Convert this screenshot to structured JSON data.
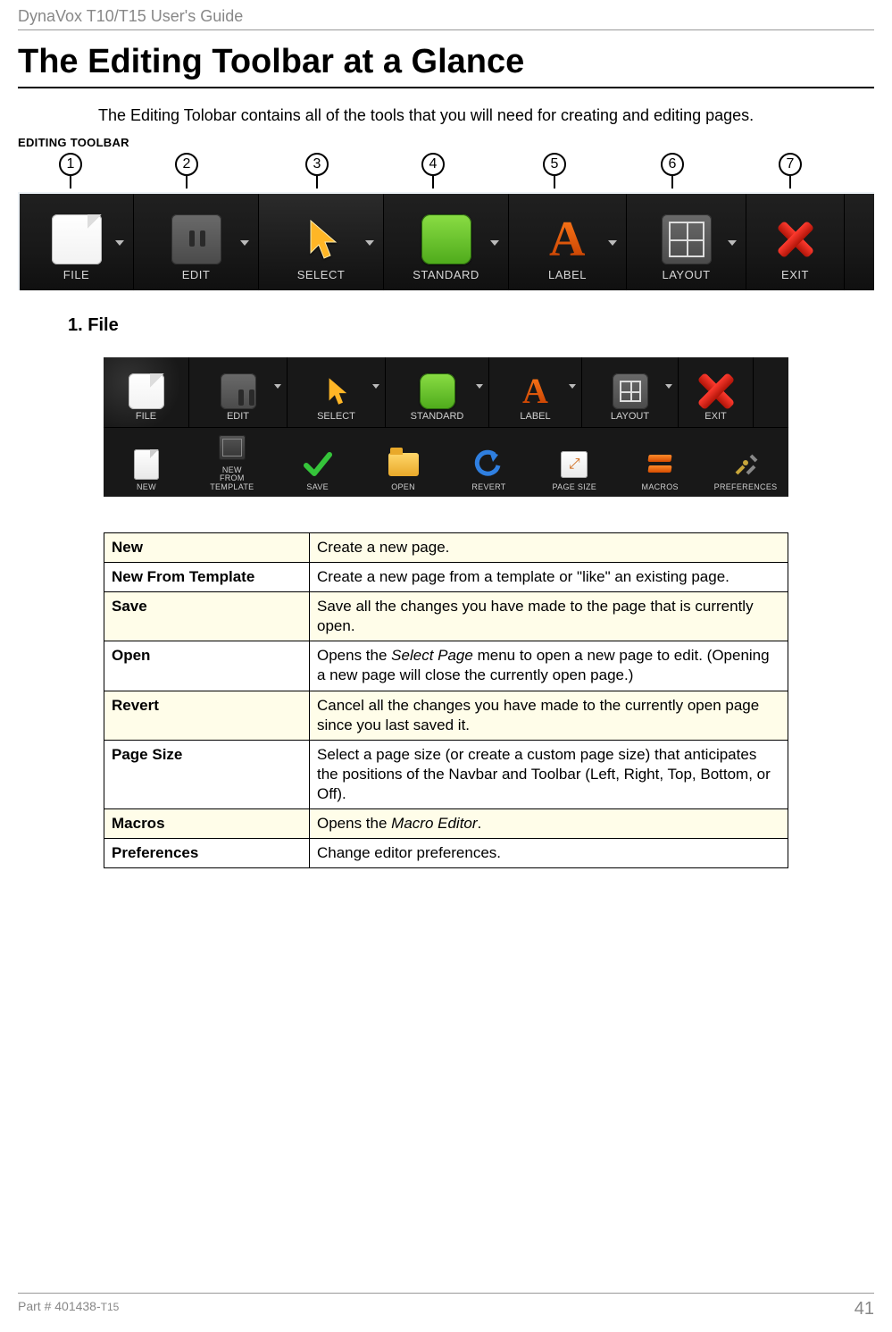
{
  "doc_header": "DynaVox T10/T15 User's Guide",
  "page_title": "The Editing Toolbar at a Glance",
  "intro_text": "The Editing Tolobar contains all of the tools that you will need for creating and editing pages.",
  "figure_label": "EDITING TOOLBAR",
  "callout_numbers": [
    "1",
    "2",
    "3",
    "4",
    "5",
    "6",
    "7"
  ],
  "toolbar_main": [
    {
      "label": "FILE"
    },
    {
      "label": "EDIT"
    },
    {
      "label": "SELECT"
    },
    {
      "label": "STANDARD"
    },
    {
      "label": "LABEL"
    },
    {
      "label": "LAYOUT"
    },
    {
      "label": "EXIT"
    }
  ],
  "section_heading": "1. File",
  "toolbar2_top": [
    {
      "label": "FILE"
    },
    {
      "label": "EDIT"
    },
    {
      "label": "SELECT"
    },
    {
      "label": "STANDARD"
    },
    {
      "label": "LABEL"
    },
    {
      "label": "LAYOUT"
    },
    {
      "label": "EXIT"
    }
  ],
  "toolbar2_sub": [
    {
      "label": "NEW"
    },
    {
      "label": "NEW\nFROM\nTEMPLATE"
    },
    {
      "label": "SAVE"
    },
    {
      "label": "OPEN"
    },
    {
      "label": "REVERT"
    },
    {
      "label": "PAGE SIZE"
    },
    {
      "label": "MACROS"
    },
    {
      "label": "PREFERENCES"
    }
  ],
  "definitions": [
    {
      "term": "New",
      "desc": "Create a new page."
    },
    {
      "term": "New From Template",
      "desc": "Create a new page from a template or \"like\" an existing page."
    },
    {
      "term": "Save",
      "desc": "Save all the changes you have made to the page that is currently open."
    },
    {
      "term": "Open",
      "desc_html": "Opens the <em>Select Page</em> menu to open a new page to edit. (Opening a new page will close the currently open page.)"
    },
    {
      "term": "Revert",
      "desc": "Cancel all the changes you have made to the currently open page since you last saved it."
    },
    {
      "term": "Page Size",
      "desc": "Select a page size (or create a custom page size) that anticipates the positions of the Navbar and Toolbar (Left, Right, Top, Bottom, or Off)."
    },
    {
      "term": "Macros",
      "desc_html": "Opens the <em>Macro Editor</em>."
    },
    {
      "term": "Preferences",
      "desc": "Change editor preferences."
    }
  ],
  "footer_part": "Part # 401438-",
  "footer_suffix": "T15",
  "page_number": "41"
}
